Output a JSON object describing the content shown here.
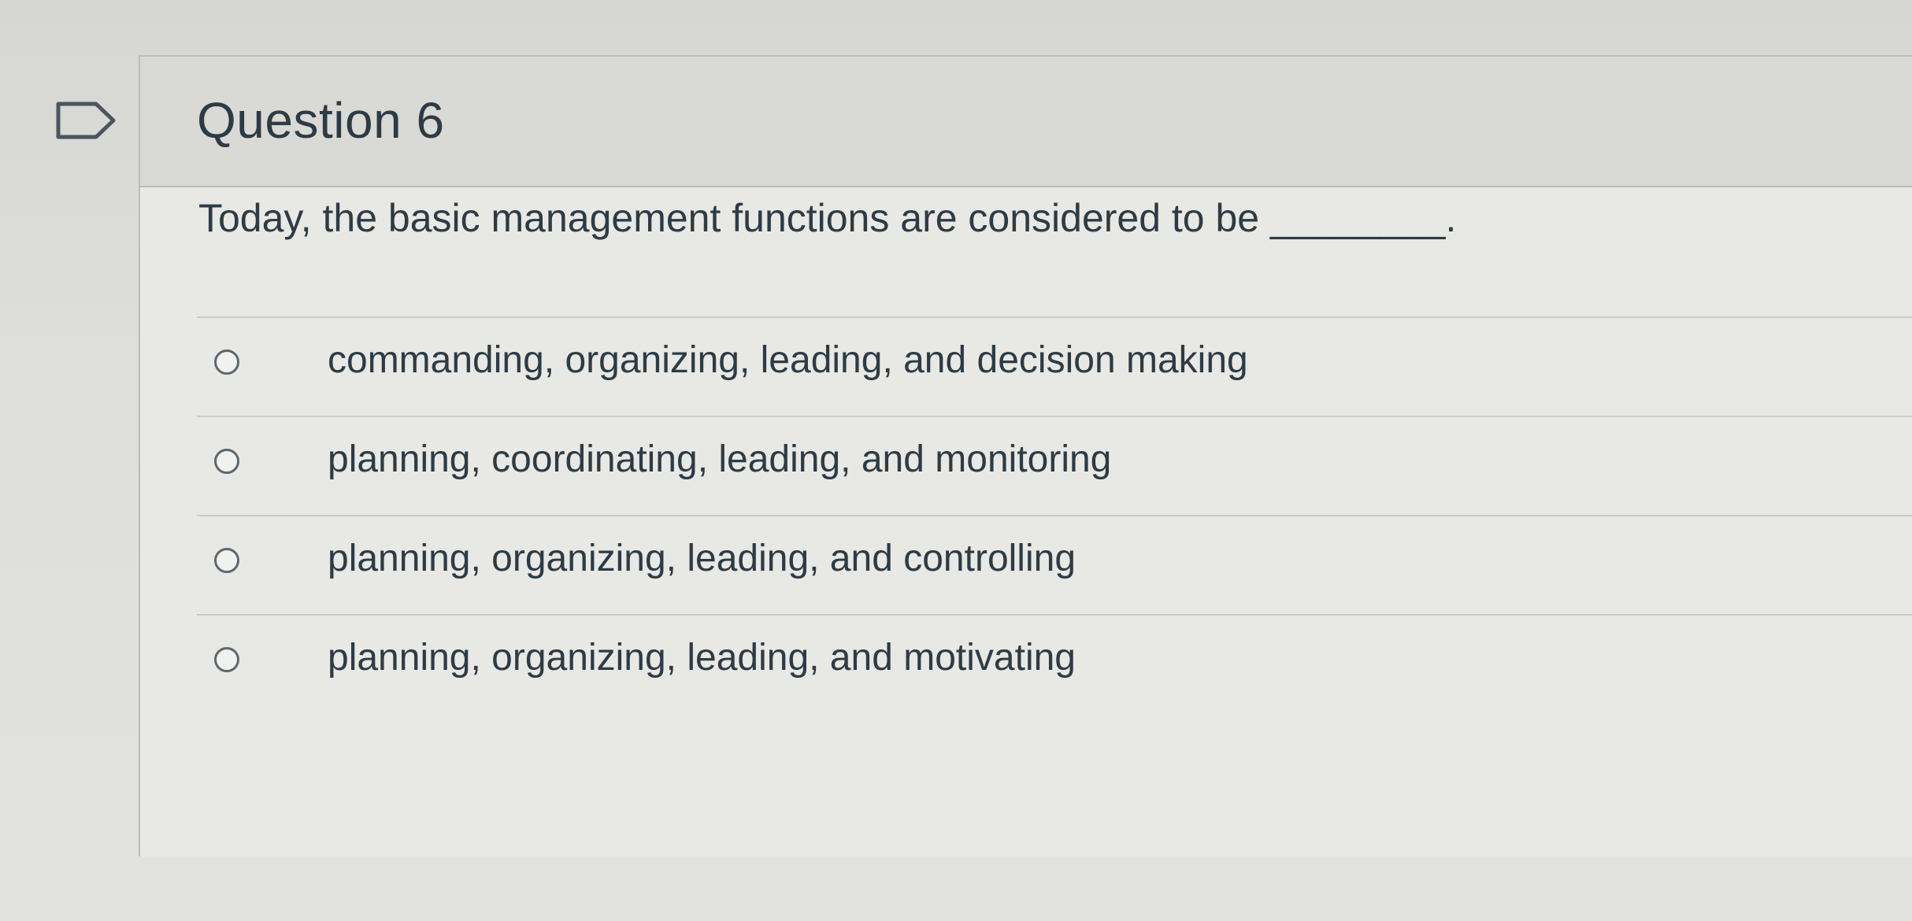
{
  "question": {
    "title": "Question 6",
    "text": "Today, the basic management functions are considered to be ________.",
    "answers": [
      {
        "label": "commanding, organizing, leading, and decision making"
      },
      {
        "label": "planning, coordinating, leading, and monitoring"
      },
      {
        "label": "planning, organizing, leading, and controlling"
      },
      {
        "label": "planning, organizing, leading, and motivating"
      }
    ]
  },
  "icons": {
    "flag": "bookmark-flag-icon",
    "radio": "radio-circle-icon"
  },
  "colors": {
    "text": "#2d3b45",
    "border": "#b9bcbf",
    "header_bg": "#d9d9d5",
    "body_bg": "#e8e8e4"
  }
}
